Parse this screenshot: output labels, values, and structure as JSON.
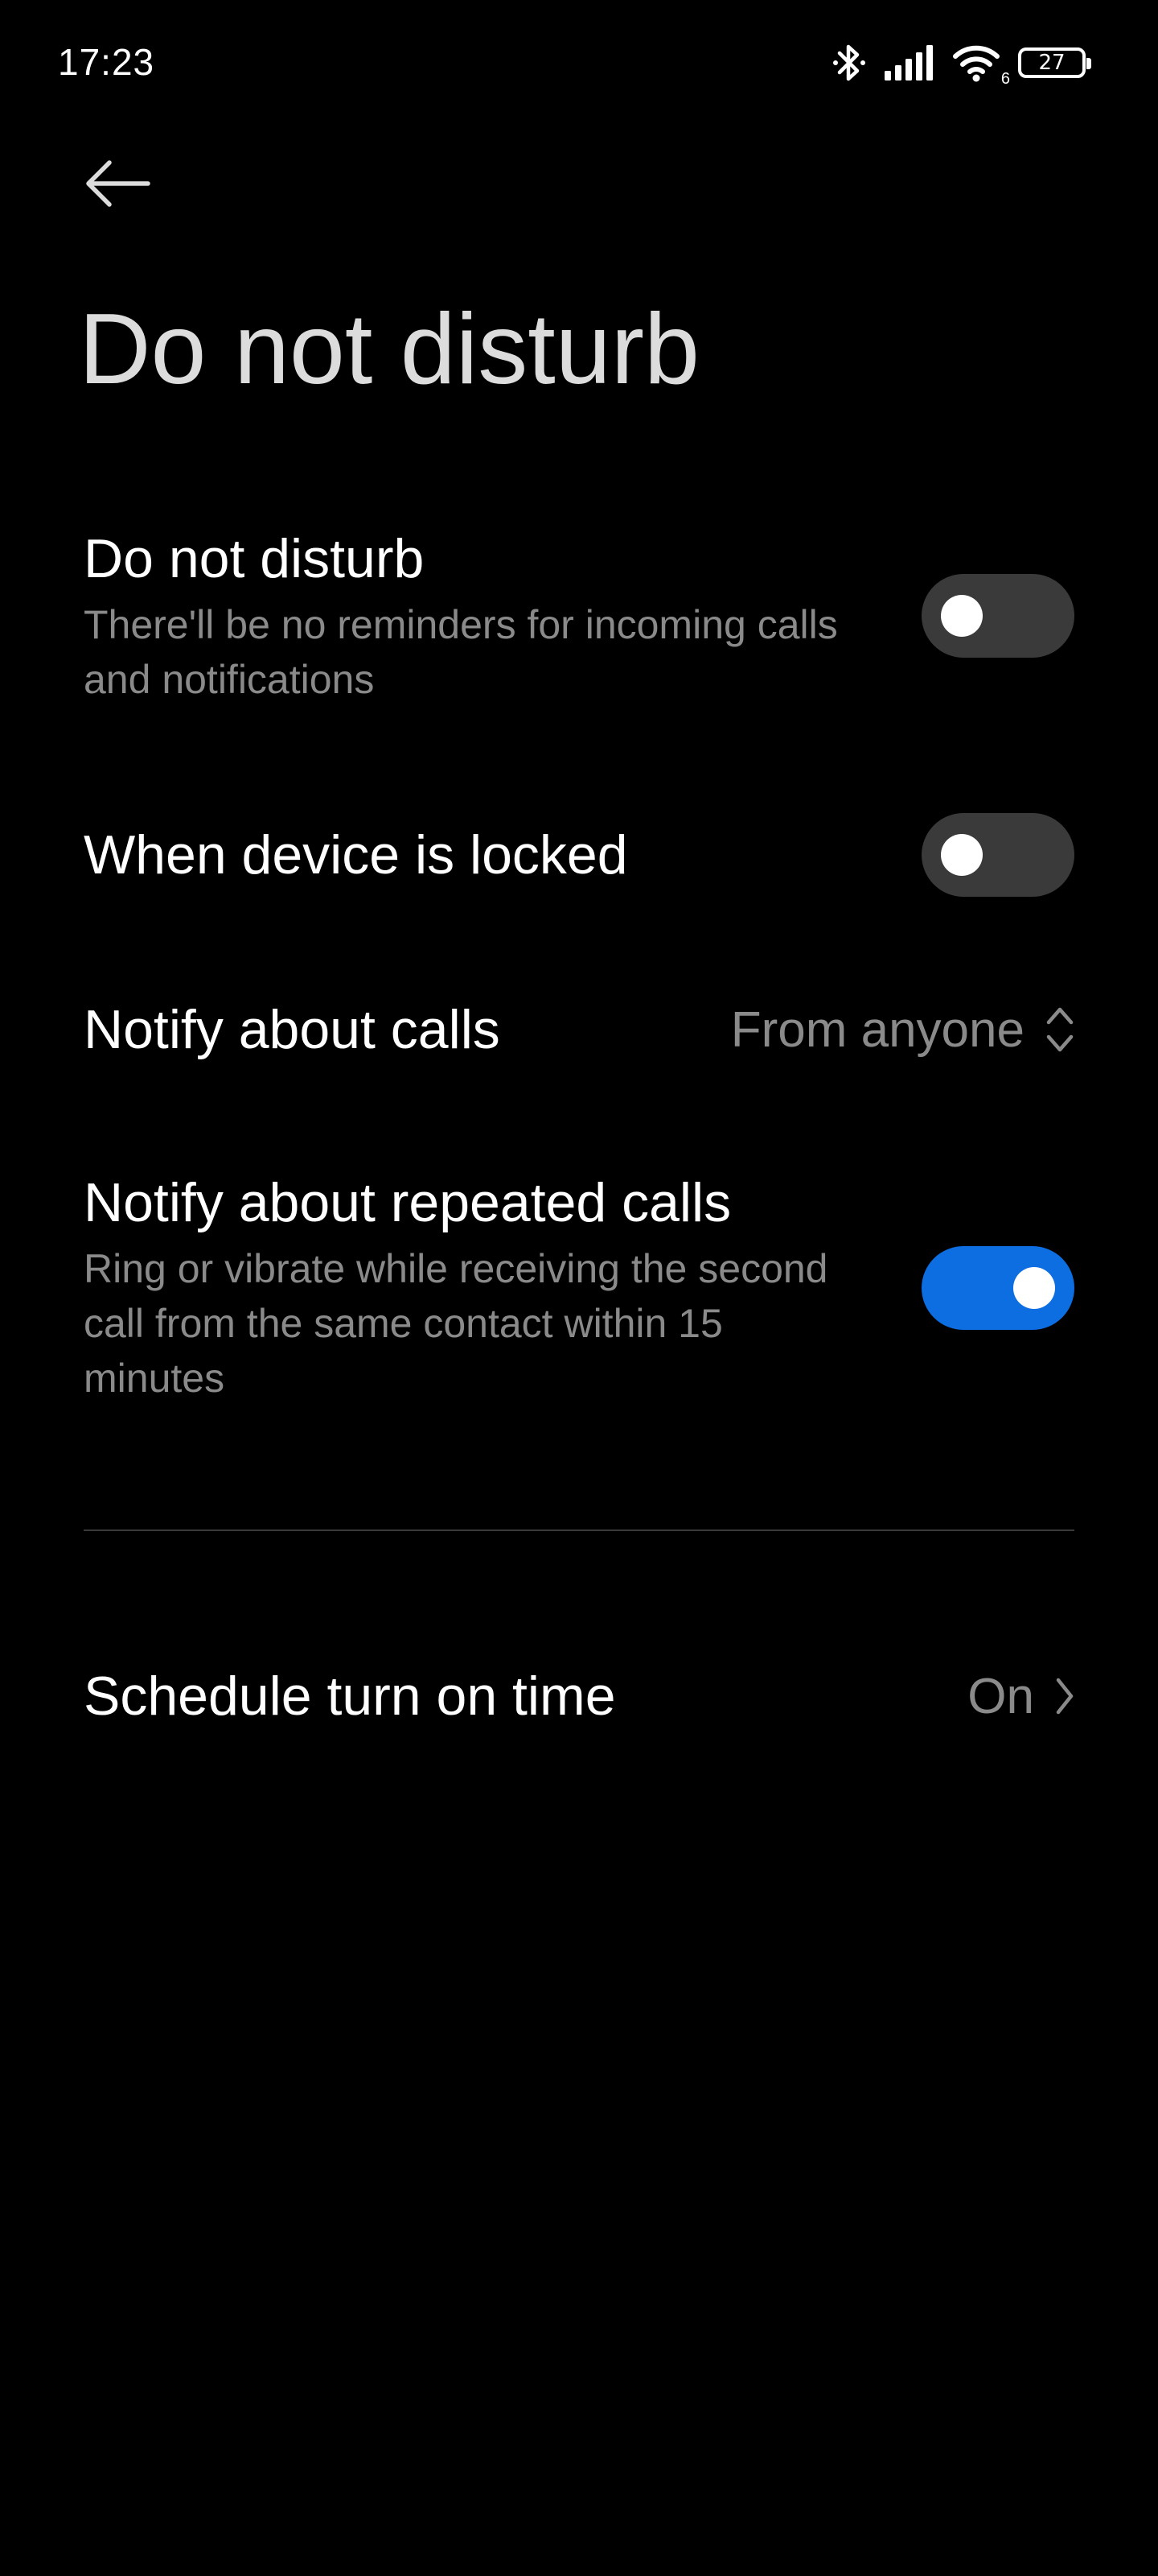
{
  "status_bar": {
    "time": "17:23",
    "battery_level": "27",
    "icons": [
      "bluetooth-icon",
      "signal-icon",
      "wifi-icon",
      "battery-icon"
    ],
    "wifi_label": "6"
  },
  "header": {
    "back_icon": "arrow-left-icon",
    "title": "Do not disturb"
  },
  "settings": {
    "dnd": {
      "title": "Do not disturb",
      "description": "There'll be no reminders for incoming calls and notifications",
      "enabled": false
    },
    "locked": {
      "title": "When device is locked",
      "enabled": false
    },
    "notify_calls": {
      "title": "Notify about calls",
      "value": "From anyone",
      "icon": "chevron-up-down-icon"
    },
    "repeated_calls": {
      "title": "Notify about repeated calls",
      "description": "Ring or vibrate while receiving the second call from the same contact within 15 minutes",
      "enabled": true
    },
    "schedule": {
      "title": "Schedule turn on time",
      "value": "On",
      "icon": "chevron-right-icon"
    }
  },
  "colors": {
    "background": "#000000",
    "toggle_on": "#0c6ee0",
    "toggle_off": "#3a3a3a",
    "secondary_text": "#8a8a8a",
    "title_text": "#dcdcdc"
  }
}
